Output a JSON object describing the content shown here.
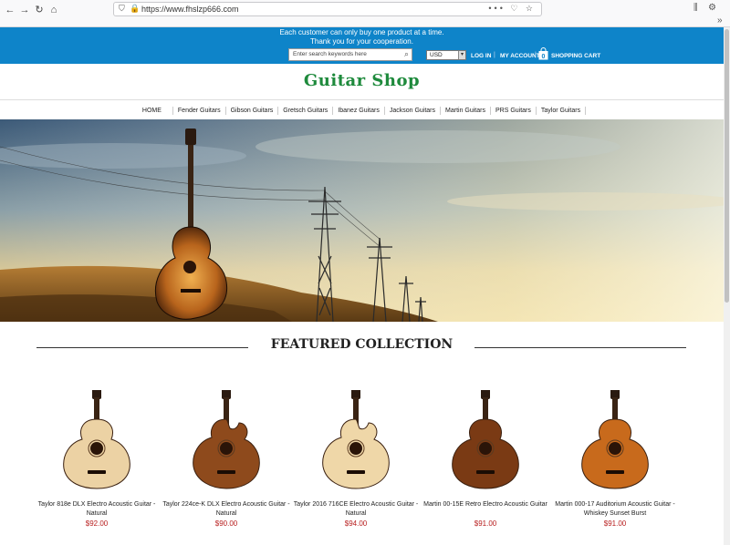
{
  "browser": {
    "url": "https://www.fhslzp666.com",
    "url_actions": "•••",
    "menu_more": "»"
  },
  "topbar": {
    "notice_line1": "Each customer can only buy one product at a time.",
    "notice_line2": "Thank you for your cooperation.",
    "search_placeholder": "Enter search keywords here",
    "currency": "USD",
    "login": "LOG IN",
    "my_account": "MY ACCOUNT",
    "cart_count": "0",
    "cart": "SHOPPING CART",
    "divider": "|"
  },
  "site": {
    "logo": "Guitar Shop"
  },
  "categories": [
    "HOME",
    "Fender Guitars",
    "Gibson Guitars",
    "Gretsch Guitars",
    "Ibanez Guitars",
    "Jackson Guitars",
    "Martin Guitars",
    "PRS Guitars",
    "Taylor Guitars"
  ],
  "featured": {
    "title": "FEATURED COLLECTION",
    "products": [
      {
        "name": "Taylor 818e DLX Electro Acoustic Guitar - Natural",
        "price": "$92.00",
        "body": "#ecd2a4",
        "cutaway": false
      },
      {
        "name": "Taylor 224ce-K DLX Electro Acoustic Guitar - Natural",
        "price": "$90.00",
        "body": "#8e4a1c",
        "cutaway": true
      },
      {
        "name": "Taylor 2016 716CE Electro Acoustic Guitar - Natural",
        "price": "$94.00",
        "body": "#efd7a8",
        "cutaway": true
      },
      {
        "name": "Martin 00-15E Retro Electro Acoustic Guitar",
        "price": "$91.00",
        "body": "#7a3a14",
        "cutaway": false
      },
      {
        "name": "Martin 000-17 Auditorium Acoustic Guitar - Whiskey Sunset Burst",
        "price": "$91.00",
        "body": "#c86a1c",
        "cutaway": false
      }
    ]
  },
  "colors": {
    "topbar": "#0e84c9",
    "logo": "#1e8a3c",
    "price": "#b71c1c"
  }
}
